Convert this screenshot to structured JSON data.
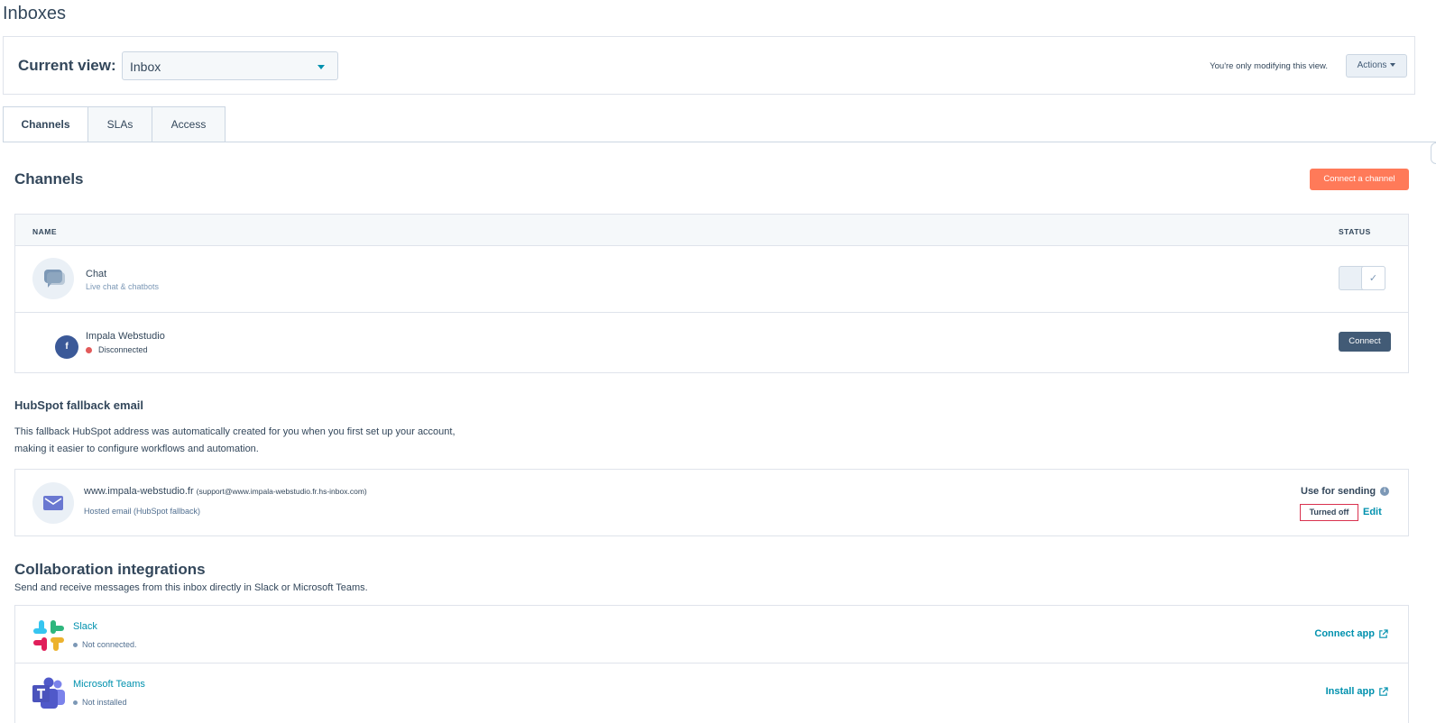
{
  "page": {
    "title": "Inboxes"
  },
  "view_bar": {
    "label": "Current view:",
    "selected": "Inbox",
    "note": "You're only modifying this view.",
    "actions_label": "Actions"
  },
  "tabs": [
    {
      "label": "Channels",
      "active": true
    },
    {
      "label": "SLAs",
      "active": false
    },
    {
      "label": "Access",
      "active": false
    }
  ],
  "channels": {
    "heading": "Channels",
    "connect_label": "Connect a channel",
    "columns": {
      "name": "NAME",
      "status": "STATUS"
    },
    "rows": [
      {
        "title": "Chat",
        "subtitle": "Live chat & chatbots",
        "icon": "chat-bubble-icon",
        "status": "toggle-on"
      },
      {
        "title": "Impala Webstudio",
        "subtitle": "Disconnected",
        "icon": "facebook-icon",
        "status_color": "#e25a5a",
        "action_label": "Connect"
      }
    ]
  },
  "fallback": {
    "heading": "HubSpot fallback email",
    "description_line1": "This fallback HubSpot address was automatically created for you when you first set up your account,",
    "description_line2": "making it easier to configure workflows and automation.",
    "domain": "www.impala-webstudio.fr",
    "address": "(support@www.impala-webstudio.fr.hs-inbox.com)",
    "subtitle": "Hosted email (HubSpot fallback)",
    "use_for_sending_label": "Use for sending",
    "status_badge": "Turned off",
    "edit_label": "Edit"
  },
  "collaboration": {
    "heading": "Collaboration integrations",
    "description": "Send and receive messages from this inbox directly in Slack or Microsoft Teams.",
    "apps": [
      {
        "name": "Slack",
        "status": "Not connected.",
        "action": "Connect app",
        "icon": "slack-icon"
      },
      {
        "name": "Microsoft Teams",
        "status": "Not installed",
        "action": "Install app",
        "icon": "teams-icon"
      }
    ]
  },
  "colors": {
    "primary_text": "#33475b",
    "link": "#0091ae",
    "accent": "#ff7a59",
    "dark_button": "#425b76",
    "error_border": "#d9324f"
  }
}
